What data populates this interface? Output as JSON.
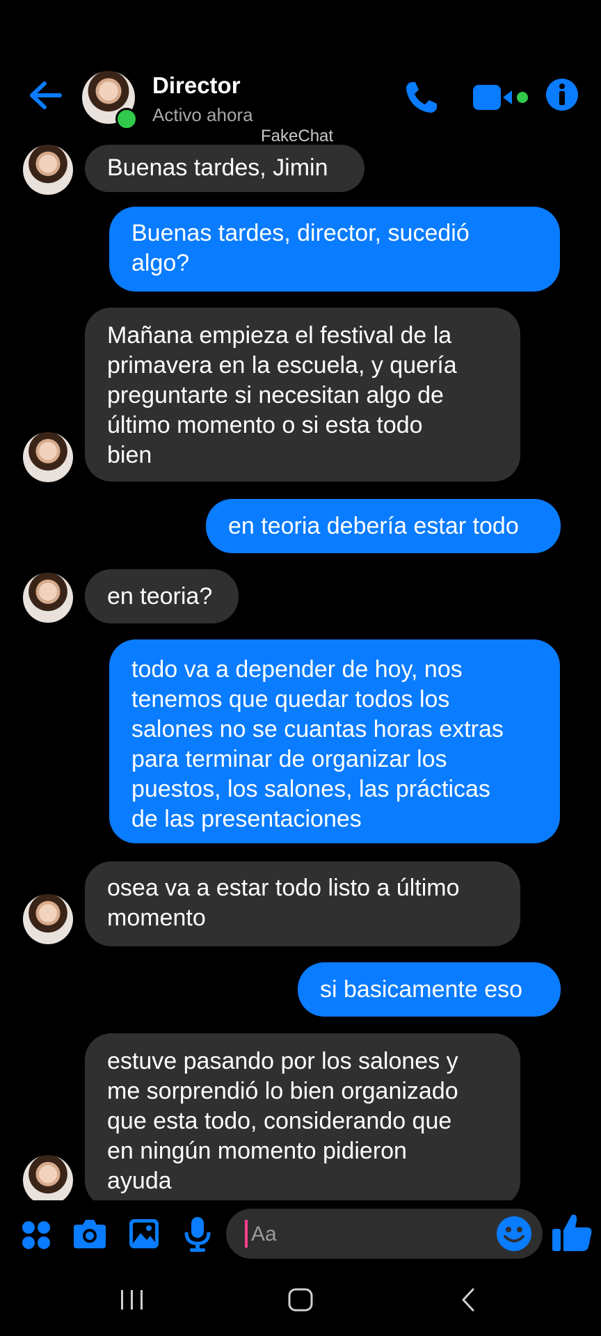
{
  "header": {
    "contact_name": "Director",
    "status": "Activo ahora",
    "watermark": "FakeChat",
    "back_icon": "back-arrow-icon",
    "call_icon": "phone-icon",
    "video_icon": "video-camera-icon",
    "info_icon": "info-icon"
  },
  "colors": {
    "accent": "#0a7cff",
    "incoming_bubble": "#303030",
    "background": "#000000",
    "online": "#31c94b"
  },
  "messages": [
    {
      "direction": "in",
      "lines": [
        "Buenas tardes, Jimin"
      ]
    },
    {
      "direction": "out",
      "lines": [
        "Buenas tardes, director, sucedió",
        "algo?"
      ]
    },
    {
      "direction": "in",
      "lines": [
        "Mañana empieza el festival de la",
        "primavera en la escuela, y quería",
        "preguntarte si necesitan algo de",
        "último momento o si esta todo",
        "bien"
      ]
    },
    {
      "direction": "out",
      "lines": [
        "en teoria debería estar todo"
      ]
    },
    {
      "direction": "in",
      "lines": [
        "en teoria?"
      ]
    },
    {
      "direction": "out",
      "lines": [
        "todo va a depender de hoy, nos",
        "tenemos que quedar todos los",
        "salones no se cuantas horas extras",
        "para terminar de organizar los",
        "puestos, los salones, las prácticas",
        "de las presentaciones"
      ]
    },
    {
      "direction": "in",
      "lines": [
        "osea va a estar todo listo a último",
        "momento"
      ]
    },
    {
      "direction": "out",
      "lines": [
        "si basicamente eso"
      ]
    },
    {
      "direction": "in",
      "lines": [
        "estuve pasando por los salones y",
        "me sorprendió lo bien organizado",
        "que esta todo, considerando que",
        "en ningún momento pidieron",
        "ayuda"
      ]
    }
  ],
  "composer": {
    "placeholder": "Aa",
    "icons": [
      "apps-grid-icon",
      "camera-icon",
      "gallery-icon",
      "microphone-icon",
      "emoji-icon",
      "thumbs-up-icon"
    ]
  },
  "system_nav": {
    "icons": [
      "recent-apps-icon",
      "home-icon",
      "back-icon"
    ]
  }
}
